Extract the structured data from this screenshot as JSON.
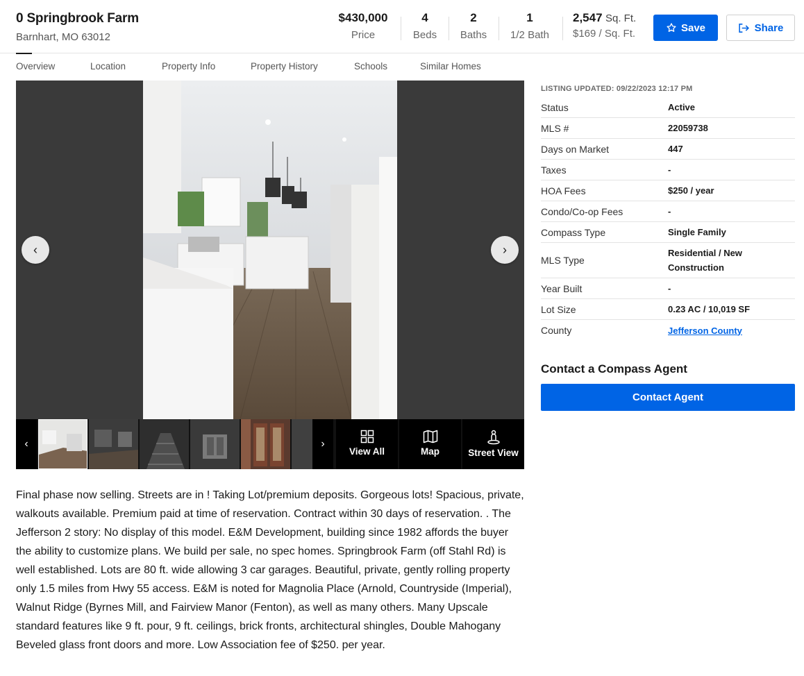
{
  "header": {
    "title": "0 Springbrook Farm",
    "subtitle": "Barnhart, MO 63012",
    "price": {
      "value": "$430,000",
      "label": "Price"
    },
    "beds": {
      "value": "4",
      "label": "Beds"
    },
    "baths": {
      "value": "2",
      "label": "Baths"
    },
    "half_bath": {
      "value": "1",
      "label": "1/2 Bath"
    },
    "sqft": {
      "value": "2,547",
      "unit": "Sq. Ft.",
      "label": "$169 / Sq. Ft."
    },
    "save_label": "Save",
    "share_label": "Share"
  },
  "tabs": [
    {
      "label": "Overview"
    },
    {
      "label": "Location"
    },
    {
      "label": "Property Info"
    },
    {
      "label": "Property History"
    },
    {
      "label": "Schools"
    },
    {
      "label": "Similar Homes"
    }
  ],
  "gallery": {
    "tools": [
      {
        "label": "View All",
        "icon": "grid-icon"
      },
      {
        "label": "Map",
        "icon": "map-icon"
      },
      {
        "label": "Street View",
        "icon": "street-view-icon"
      }
    ]
  },
  "listing_updated": "LISTING UPDATED: 09/22/2023 12:17 PM",
  "facts": [
    {
      "key": "Status",
      "value": "Active"
    },
    {
      "key": "MLS #",
      "value": "22059738"
    },
    {
      "key": "Days on Market",
      "value": "447"
    },
    {
      "key": "Taxes",
      "value": "-"
    },
    {
      "key": "HOA Fees",
      "value": "$250 / year"
    },
    {
      "key": "Condo/Co-op Fees",
      "value": "-"
    },
    {
      "key": "Compass Type",
      "value": "Single Family"
    },
    {
      "key": "MLS Type",
      "value": "Residential / New Construction"
    },
    {
      "key": "Year Built",
      "value": "-"
    },
    {
      "key": "Lot Size",
      "value": "0.23 AC / 10,019 SF"
    },
    {
      "key": "County",
      "value": "Jefferson County"
    }
  ],
  "contact": {
    "title": "Contact a Compass Agent",
    "button_label": "Contact Agent"
  },
  "description": "Final phase now selling. Streets are in ! Taking Lot/premium deposits. Gorgeous lots! Spacious, private, walkouts available. Premium paid at time of reservation. Contract within 30 days of reservation. . The Jefferson 2 story: No display of this model. E&M Development, building since 1982 affords the buyer the ability to customize plans. We build per sale, no spec homes. Springbrook Farm (off Stahl Rd) is well established. Lots are 80 ft. wide allowing 3 car garages. Beautiful, private, gently rolling property only 1.5 miles from Hwy 55 access. E&M is noted for Magnolia Place (Arnold, Countryside (Imperial), Walnut Ridge (Byrnes Mill, and Fairview Manor (Fenton), as well as many others. Many Upscale standard features like 9 ft. pour, 9 ft. ceilings, brick fronts, architectural shingles, Double Mahogany Beveled glass front doors and more. Low Association fee of $250. per year.",
  "colors": {
    "accent": "#0064e5"
  }
}
